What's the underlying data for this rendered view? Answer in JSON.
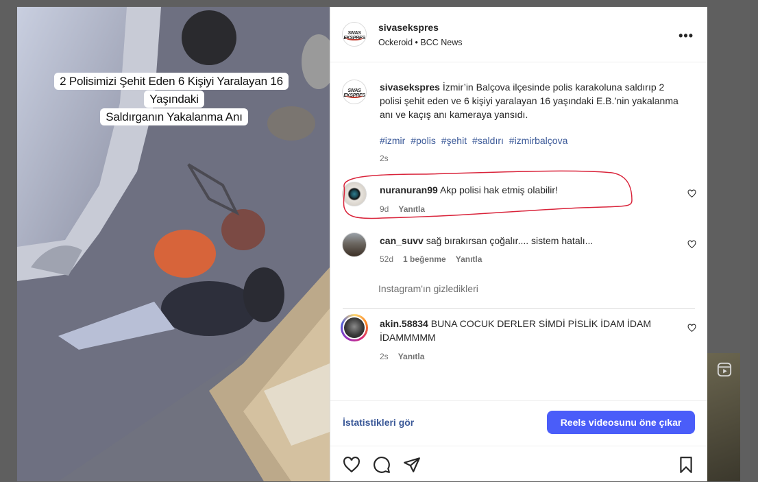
{
  "media": {
    "overlay_title_line1": "2 Polisimizi Şehit Eden 6 Kişiyi Yaralayan 16 Yaşındaki",
    "overlay_title_line2": "Saldırganın Yakalanma Anı"
  },
  "post": {
    "author": "sivasekspres",
    "audio_artist": "Ockeroid",
    "separator": "•",
    "audio_title": "BCC News",
    "more_label": "•••",
    "logo_text": "SIVAS EKSPRES"
  },
  "caption": {
    "username": "sivasekspres",
    "text": "İzmir’in Balçova ilçesinde polis karakoluna saldırıp 2 polisi şehit eden ve 6 kişiyi yaralayan 16 yaşındaki E.B.’nin yakalanma anı ve kaçış anı kameraya yansıdı.",
    "hashtags": [
      "#izmir",
      "#polis",
      "#şehit",
      "#saldırı",
      "#izmirbalçova"
    ],
    "time": "2s"
  },
  "comments": [
    {
      "username": "nuranuran99",
      "text": "Akp polisi hak etmiş olabilir!",
      "time": "9d",
      "likes": "",
      "reply_label": "Yanıtla"
    },
    {
      "username": "can_suvv",
      "text": "sağ bırakırsan çoğalır.... sistem hatalı...",
      "time": "52d",
      "likes": "1 beğenme",
      "reply_label": "Yanıtla"
    },
    {
      "username": "akin.58834",
      "text": "BUNA COCUK DERLER SİMDİ PİSLİK İDAM İDAM İDAMMMMM",
      "time": "2s",
      "likes": "",
      "reply_label": "Yanıtla"
    }
  ],
  "hidden_comments_label": "Instagram'ın gizledikleri",
  "footer": {
    "stats_link": "İstatistikleri gör",
    "promote_button": "Reels videosunu öne çıkar"
  },
  "actions": [
    "like-icon",
    "comment-icon",
    "share-icon",
    "save-icon"
  ],
  "colors": {
    "link_blue": "#3b5998",
    "button_blue": "#4a5df9",
    "annotation_red": "#d9233a",
    "muted_text": "#737373"
  }
}
